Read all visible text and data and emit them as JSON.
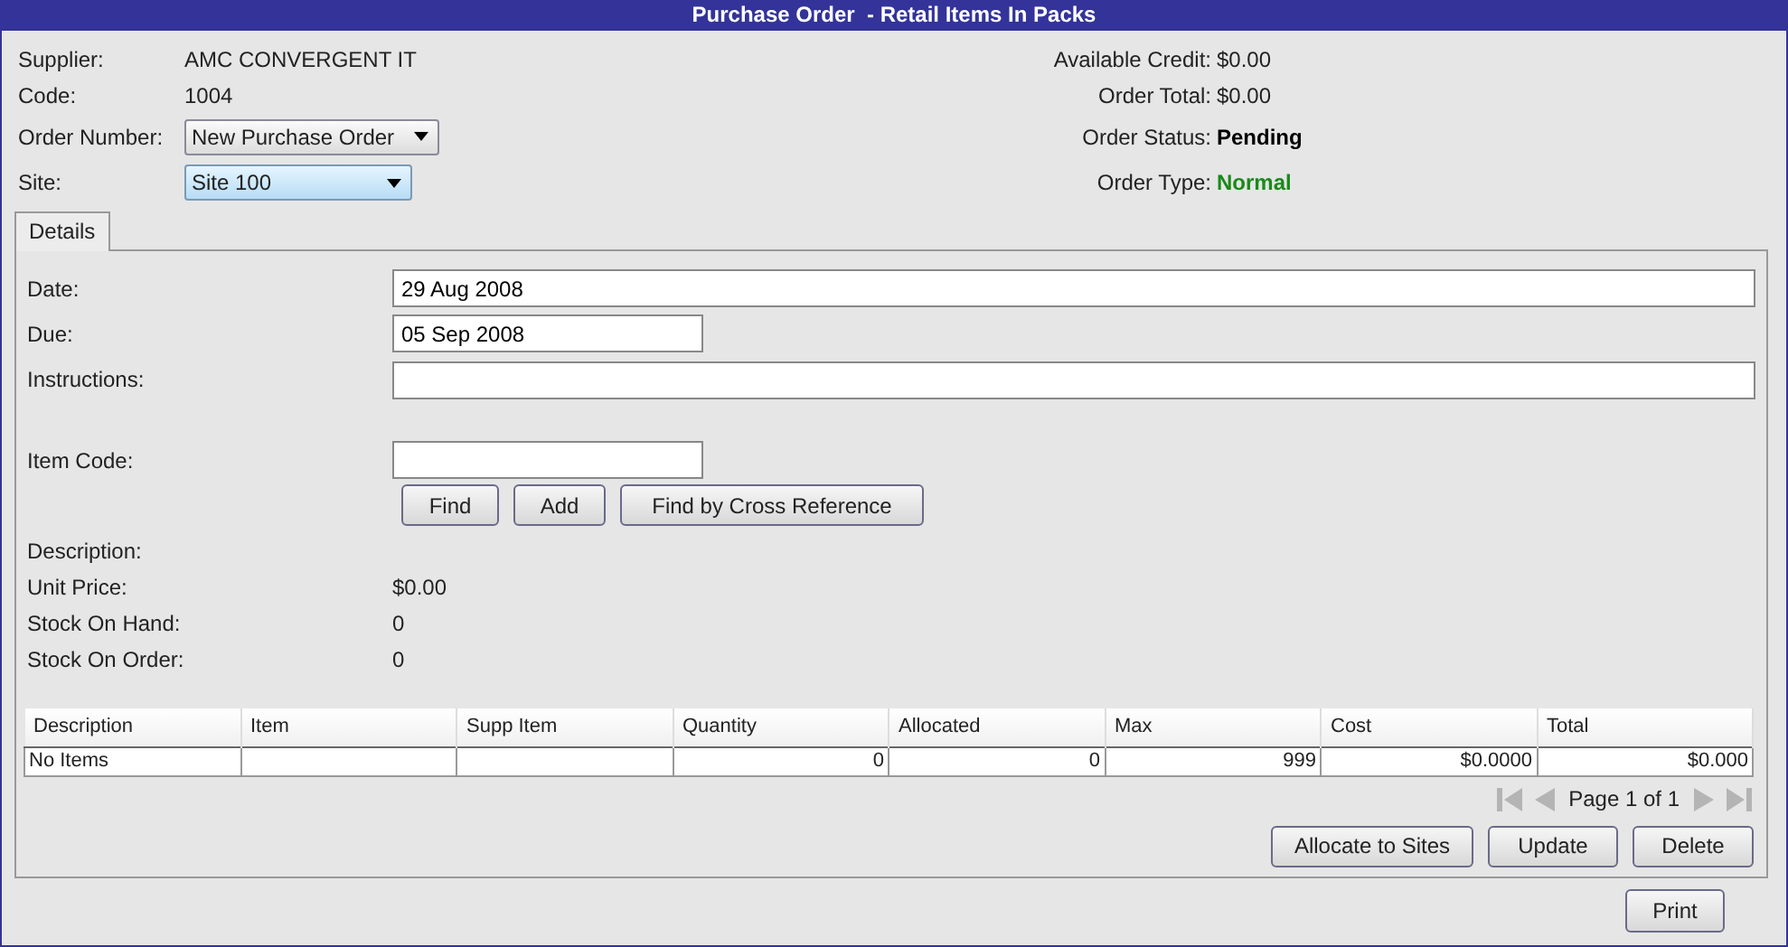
{
  "window": {
    "title": "Purchase Order  - Retail Items In Packs"
  },
  "header_left": [
    {
      "label": "Supplier:",
      "kind": "text",
      "value": "AMC CONVERGENT IT"
    },
    {
      "label": "Code:",
      "kind": "text",
      "value": "1004"
    },
    {
      "label": "Order Number:",
      "kind": "dropdown",
      "value": "New Purchase Order",
      "highlighted": false
    },
    {
      "label": "Site:",
      "kind": "dropdown",
      "value": "Site 100",
      "highlighted": true
    }
  ],
  "header_right": [
    {
      "label": "Available Credit:",
      "value": "$0.00",
      "kind": "amount"
    },
    {
      "label": "Order Total:",
      "value": "$0.00",
      "kind": "amount"
    },
    {
      "label": "Order Status:",
      "value": "Pending",
      "kind": "status"
    },
    {
      "label": "Order Type:",
      "value": "Normal",
      "kind": "type"
    }
  ],
  "tabs": [
    {
      "label": "Details",
      "selected": true
    }
  ],
  "fields": [
    {
      "label": "Date:",
      "value": "29 Aug 2008"
    },
    {
      "label": "Due:",
      "value": "05 Sep 2008"
    },
    {
      "label": "Instructions:"
    }
  ],
  "item_code": {
    "label": "Item Code:"
  },
  "search_buttons": [
    "Find",
    "Add",
    "Find by Cross Reference"
  ],
  "info": [
    {
      "label": "Description:"
    },
    {
      "label": "Unit Price:",
      "value": "$0.00"
    },
    {
      "label": "Stock On Hand:",
      "value": "0"
    },
    {
      "label": "Stock On Order:",
      "value": "0"
    }
  ],
  "table": {
    "columns": [
      "Description",
      "Item",
      "Supp Item",
      "Quantity",
      "Allocated",
      "Max",
      "Cost",
      "Total"
    ],
    "rows": [
      [
        "No Items",
        "",
        "",
        "0",
        "0",
        "999",
        "$0.0000",
        "$0.000"
      ]
    ]
  },
  "pager": {
    "text": "Page 1 of 1"
  },
  "action_buttons": [
    "Allocate to Sites",
    "Update",
    "Delete"
  ],
  "footer_buttons": [
    "Print"
  ]
}
